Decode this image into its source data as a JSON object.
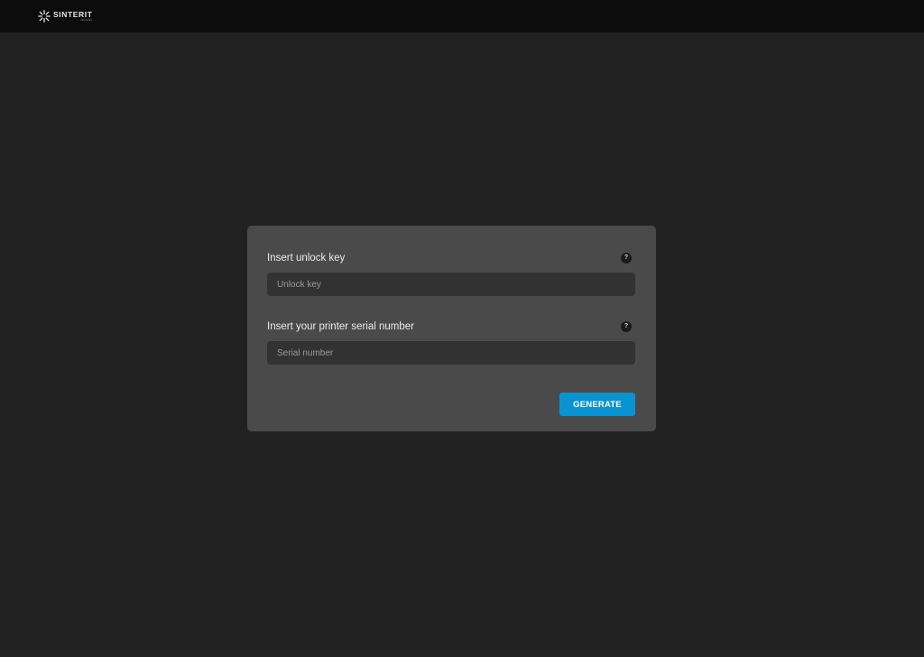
{
  "header": {
    "brand_name": "SINTERIT",
    "brand_tagline": "3D printers",
    "logo_icon": "sinterit-star-icon"
  },
  "form": {
    "unlock_key": {
      "label": "Insert unlock key",
      "placeholder": "Unlock key",
      "value": "",
      "help_icon": "?"
    },
    "serial_number": {
      "label": "Insert your printer serial number",
      "placeholder": "Serial number",
      "value": "",
      "help_icon": "?"
    },
    "generate_label": "GENERATE"
  },
  "colors": {
    "page_background": "#212121",
    "topbar_background": "#0c0c0c",
    "card_background": "#4a4a4a",
    "input_background": "#323232",
    "accent": "#0a93d1"
  }
}
